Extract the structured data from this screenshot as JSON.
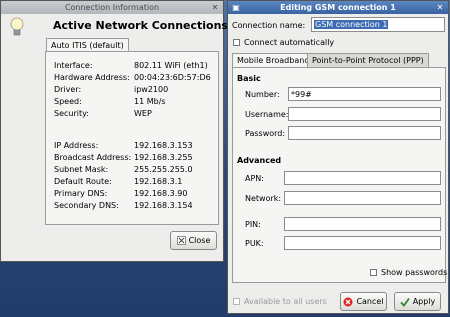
{
  "info_window": {
    "title": "Connection Information",
    "heading": "Active Network Connections",
    "tab_label": "Auto ITIS (default)",
    "rows1": [
      {
        "label": "Interface:",
        "value": "802.11 WiFi (eth1)"
      },
      {
        "label": "Hardware Address:",
        "value": "00:04:23:6D:57:D6"
      },
      {
        "label": "Driver:",
        "value": "ipw2100"
      },
      {
        "label": "Speed:",
        "value": "11 Mb/s"
      },
      {
        "label": "Security:",
        "value": "WEP"
      }
    ],
    "rows2": [
      {
        "label": "IP Address:",
        "value": "192.168.3.153"
      },
      {
        "label": "Broadcast Address:",
        "value": "192.168.3.255"
      },
      {
        "label": "Subnet Mask:",
        "value": "255.255.255.0"
      },
      {
        "label": "Default Route:",
        "value": "192.168.3.1"
      },
      {
        "label": "Primary DNS:",
        "value": "192.168.3.90"
      },
      {
        "label": "Secondary DNS:",
        "value": "192.168.3.154"
      }
    ],
    "close_label": "Close"
  },
  "edit_window": {
    "title": "Editing GSM connection 1",
    "name_label": "Connection name:",
    "name_value": "GSM connection 1",
    "auto_connect_label": "Connect automatically",
    "tabs": [
      "Mobile Broadband",
      "Point-to-Point Protocol (PPP)"
    ],
    "basic_heading": "Basic",
    "number_label": "Number:",
    "number_value": "*99#",
    "username_label": "Username:",
    "password_label": "Password:",
    "advanced_heading": "Advanced",
    "apn_label": "APN:",
    "network_label": "Network:",
    "pin_label": "PIN:",
    "puk_label": "PUK:",
    "show_passwords_label": "Show passwords",
    "available_all_label": "Available to all users",
    "cancel_label": "Cancel",
    "apply_label": "Apply"
  }
}
